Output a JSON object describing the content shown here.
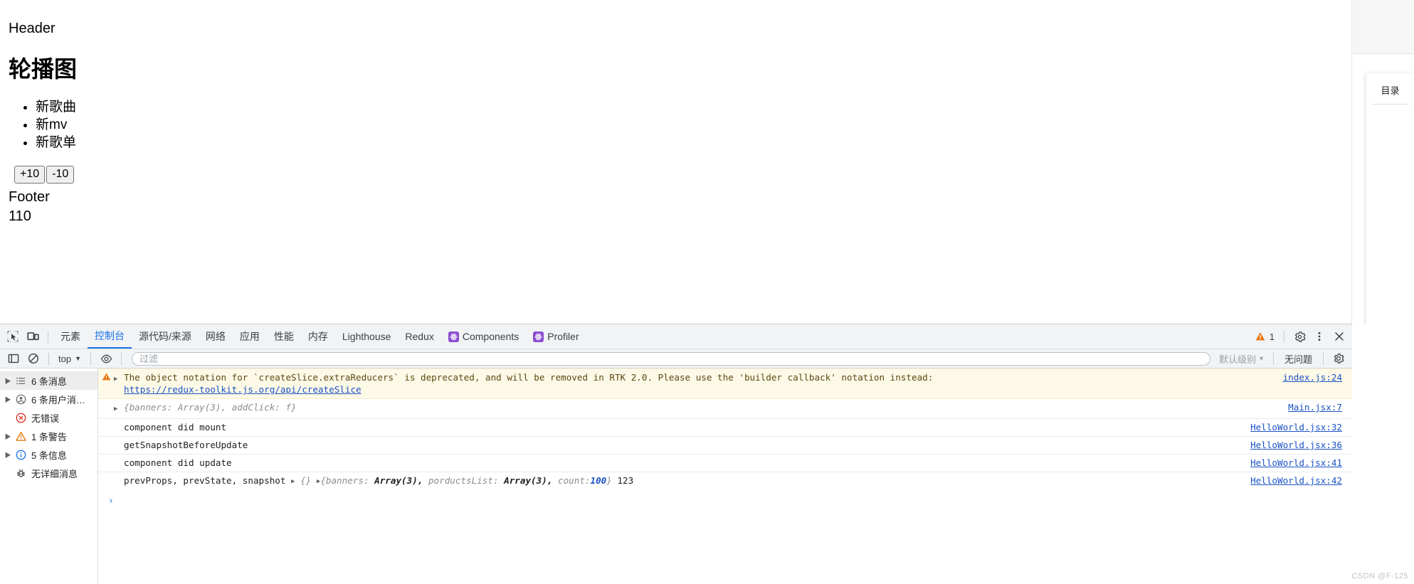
{
  "page": {
    "header_text": "Header",
    "title": "轮播图",
    "list": [
      "新歌曲",
      "新mv",
      "新歌单"
    ],
    "buttons": [
      {
        "label": "+10",
        "name": "increment-button"
      },
      {
        "label": "-10",
        "name": "decrement-button"
      }
    ],
    "footer_text": "Footer",
    "count_value": "110",
    "toc_title": "目录"
  },
  "devtools": {
    "inspect_icon": "inspect-element-icon",
    "device_icon": "device-toolbar-icon",
    "tabs": [
      {
        "label": "元素",
        "active": false,
        "badge": false
      },
      {
        "label": "控制台",
        "active": true,
        "badge": false
      },
      {
        "label": "源代码/来源",
        "active": false,
        "badge": false
      },
      {
        "label": "网络",
        "active": false,
        "badge": false
      },
      {
        "label": "应用",
        "active": false,
        "badge": false
      },
      {
        "label": "性能",
        "active": false,
        "badge": false
      },
      {
        "label": "内存",
        "active": false,
        "badge": false
      },
      {
        "label": "Lighthouse",
        "active": false,
        "badge": false
      },
      {
        "label": "Redux",
        "active": false,
        "badge": false
      },
      {
        "label": "Components",
        "active": false,
        "badge": true
      },
      {
        "label": "Profiler",
        "active": false,
        "badge": true
      }
    ],
    "warning_count": "1",
    "settings_icon": "gear-icon",
    "more_icon": "more-vertical-icon",
    "close_icon": "close-icon",
    "filterbar": {
      "sidebar_toggle_icon": "console-sidebar-toggle-icon",
      "clear_icon": "clear-console-icon",
      "context": "top",
      "eye_icon": "live-expression-icon",
      "filter_placeholder": "过滤",
      "filter_value": "",
      "level": "默认级别",
      "issues": "无问题",
      "settings_icon": "console-settings-gear-icon"
    },
    "sidebar": [
      {
        "label": "6 条消息",
        "icon": "list-icon",
        "arrow": true,
        "selected": true,
        "color": "#5f6368"
      },
      {
        "label": "6 条用户消…",
        "icon": "user-icon",
        "arrow": true,
        "selected": false,
        "color": "#5f6368"
      },
      {
        "label": "无错误",
        "icon": "error-icon",
        "arrow": false,
        "selected": false,
        "color": "#d93025"
      },
      {
        "label": "1 条警告",
        "icon": "warning-icon",
        "arrow": true,
        "selected": false,
        "color": "#e37400"
      },
      {
        "label": "5 条信息",
        "icon": "info-icon",
        "arrow": true,
        "selected": false,
        "color": "#1a73e8"
      },
      {
        "label": "无详细消息",
        "icon": "verbose-bug-icon",
        "arrow": false,
        "selected": false,
        "color": "#3c4043"
      }
    ],
    "messages": [
      {
        "type": "warning",
        "text": "The object notation for `createSlice.extraReducers` is deprecated, and will be removed in RTK 2.0. Please use the 'builder callback' notation instead:",
        "link_text": "https://redux-toolkit.js.org/api/createSlice",
        "source": "index.js:24"
      },
      {
        "type": "object",
        "text": "{banners: Array(3), addClick: f}",
        "source": "Main.jsx:7"
      },
      {
        "type": "log",
        "text": "component did mount",
        "source": "HelloWorld.jsx:32"
      },
      {
        "type": "log",
        "text": "getSnapshotBeforeUpdate",
        "source": "HelloWorld.jsx:36"
      },
      {
        "type": "log",
        "text": "component did update",
        "source": "HelloWorld.jsx:41"
      },
      {
        "type": "multi",
        "prefix": "prevProps, prevState, snapshot",
        "obj1": "{}",
        "obj2_open": "{",
        "obj2_k1": "banners:",
        "obj2_v1": "Array(3),",
        "obj2_k2": "porductsList:",
        "obj2_v2": "Array(3),",
        "obj2_k3": "count:",
        "obj2_v3": "100",
        "obj2_close": "}",
        "suffix": "123",
        "source": "HelloWorld.jsx:42"
      }
    ],
    "prompt_caret": "›"
  },
  "watermark": "CSDN @F-125"
}
